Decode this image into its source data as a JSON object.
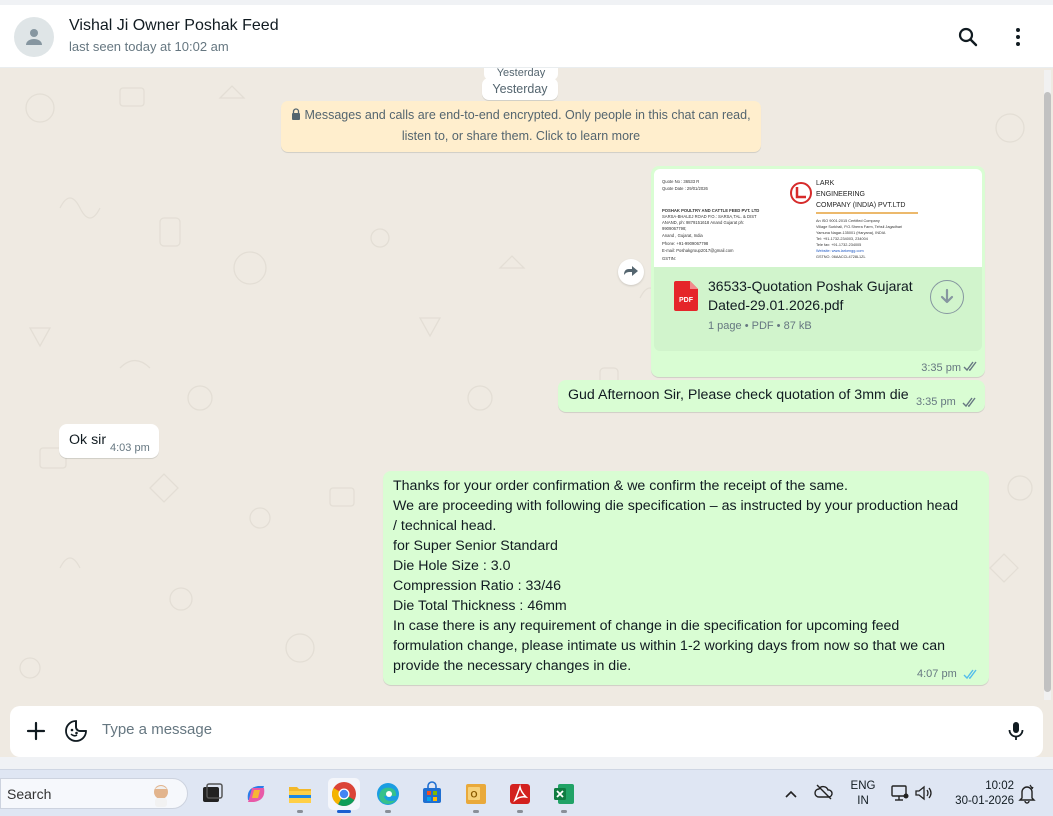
{
  "header": {
    "contact_name": "Vishal Ji Owner Poshak Feed",
    "last_seen": "last seen today at 10:02 am"
  },
  "chat": {
    "date_divider": "Yesterday",
    "date_divider_sticky": "Yesterday",
    "encryption_notice_line1": "Messages and calls are end-to-end encrypted. Only people in this chat can read,",
    "encryption_notice_line2": "listen to, or share them. Click to learn more",
    "messages": [
      {
        "type": "document",
        "direction": "outgoing",
        "file_name_line1": "36533-Quotation Poshak Gujarat",
        "file_name_line2": "Dated-29.01.2026.pdf",
        "file_meta": "1 page • PDF • 87 kB",
        "file_badge": "PDF",
        "time": "3:35 pm",
        "status": "delivered",
        "preview": {
          "left_lines": [
            "Quote No : 36533 R",
            "Quote Date : 29/01/2026",
            "",
            "POSHAK POULTRY AND CATTLE FEED PVT. LTD",
            "SARSA-BHALEJ ROAD P.O.: SARSA,TAL. & DIST",
            "ANAND, ph: 9879151618 Anand Gujarat ph:",
            "9909067798;",
            "Anand , Gujarat, India",
            "Phone: +91-9909067798",
            "E-mail: Poshakgroup2017@gmail.com",
            "GSTIN:"
          ],
          "company_line1": "LARK",
          "company_line2": "ENGINEERING",
          "company_line3": "COMPANY (INDIA) PVT.LTD",
          "right_lines": [
            "An ISO 9001:2015 Certified Company",
            "Village Surkhali, P.O.Sherra Farm, Tehsil Jagadhari",
            "Yamuna Nagar-135001 (Haryana), INDIA",
            "Tel: +91-1732-234003, 234004",
            "Tele fax: +91-1732-234005",
            "Website: www.larkengg.com",
            "GSTNO. 06AACCL4728L1ZL"
          ]
        }
      },
      {
        "type": "text",
        "direction": "outgoing",
        "text": "Gud Afternoon Sir, Please check quotation of 3mm die",
        "time": "3:35 pm",
        "status": "delivered"
      },
      {
        "type": "text",
        "direction": "incoming",
        "text": "Ok sir",
        "time": "4:03 pm"
      },
      {
        "type": "text",
        "direction": "outgoing",
        "lines": [
          "Thanks for your order confirmation & we confirm the receipt of the same.",
          "We are proceeding with following die specification –  as instructed by your production head",
          "/ technical head.",
          "for Super Senior Standard",
          "Die Hole Size : 3.0",
          "Compression Ratio : 33/46",
          "Die Total Thickness : 46mm",
          "In case there is any requirement of change in die specification for upcoming feed",
          "formulation change, please intimate us within 1-2 working days from now so that we can",
          "provide the necessary changes in die."
        ],
        "time": "4:07 pm",
        "status": "read"
      }
    ]
  },
  "composer": {
    "placeholder": "Type a message"
  },
  "taskbar": {
    "search_label": "Search",
    "apps": [
      "task-view",
      "copilot",
      "file-explorer",
      "chrome",
      "edge",
      "store",
      "outlook",
      "acrobat",
      "excel"
    ],
    "language_line1": "ENG",
    "language_line2": "IN",
    "time": "10:02",
    "date": "30-01-2026"
  },
  "colors": {
    "outgoing_bubble": "#d9fdd3",
    "incoming_bubble": "#ffffff",
    "chat_background": "#efeae2",
    "read_ticks": "#53bdeb",
    "delivered_ticks": "#667781",
    "pdf_red": "#e5252a"
  }
}
